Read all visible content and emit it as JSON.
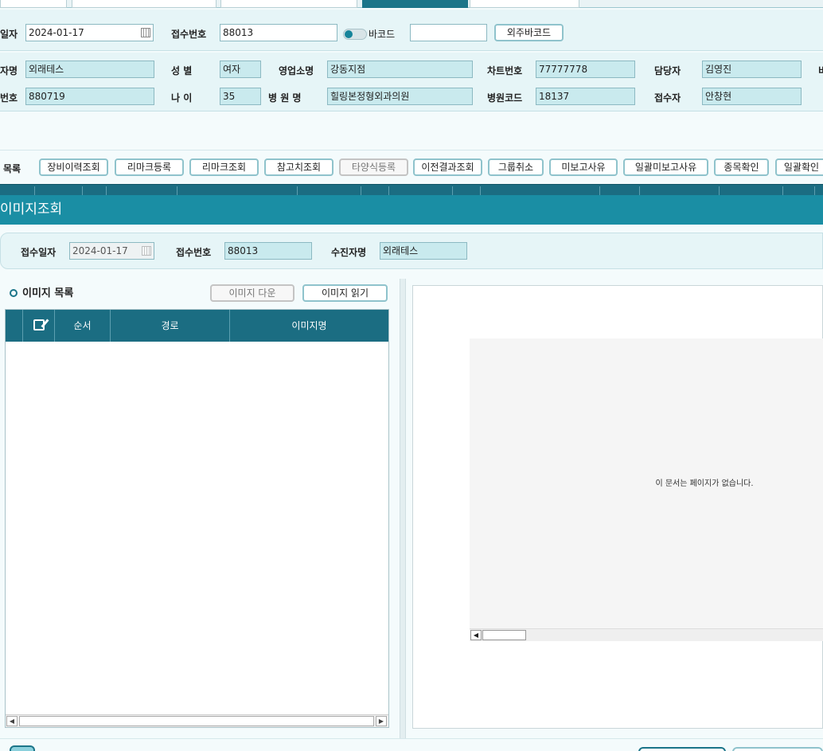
{
  "header": {
    "date_label": "일자",
    "date_value": "2024-01-17",
    "receipt_no_label": "접수번호",
    "receipt_no_value": "88013",
    "barcode_label": "바코드",
    "barcode_value": "",
    "outsource_barcode_button": "외주바코드"
  },
  "patient": {
    "name_label": "자명",
    "name_value": "외래테스",
    "gender_label": "성 별",
    "gender_value": "여자",
    "sales_office_label": "영업소명",
    "sales_office_value": "강동지점",
    "chart_no_label": "차트번호",
    "chart_no_value": "77777778",
    "manager_label": "담당자",
    "manager_value": "김영진",
    "edge_label": "비",
    "number_label": "번호",
    "number_value": "880719",
    "age_label": "나 이",
    "age_value": "35",
    "hospital_label": "병 원 명",
    "hospital_value": "힐링본정형외과의원",
    "hospital_code_label": "병원코드",
    "hospital_code_value": "18137",
    "receiver_label": "접수자",
    "receiver_value": "안창현"
  },
  "toolbar": {
    "list_label": "목록",
    "buttons": [
      "장비이력조회",
      "리마크등록",
      "리마크조회",
      "참고치조회",
      "타양식등록",
      "이전결과조회",
      "그룹취소",
      "미보고사유",
      "일괄미보고사유",
      "종목확인",
      "일괄확인"
    ]
  },
  "dialog": {
    "title": "이미지조회",
    "receipt_date_label": "접수일자",
    "receipt_date_value": "2024-01-17",
    "receipt_no_label": "접수번호",
    "receipt_no_value": "88013",
    "patient_name_label": "수진자명",
    "patient_name_value": "외래테스",
    "image_list_title": "이미지 목록",
    "image_download_button": "이미지 다운",
    "image_read_button": "이미지 읽기",
    "columns": [
      "순서",
      "경로",
      "이미지명"
    ],
    "viewer_message": "이 문서는 페이지가 없습니다."
  },
  "icons": [
    "calendar-icon",
    "edit-icon",
    "scroll-left-icon",
    "scroll-right-icon"
  ],
  "colors": {
    "primary": "#1a8ea4",
    "header_dark": "#1b6d82",
    "field_bg": "#c9eaee",
    "panel_bg": "#e6f5f7"
  }
}
